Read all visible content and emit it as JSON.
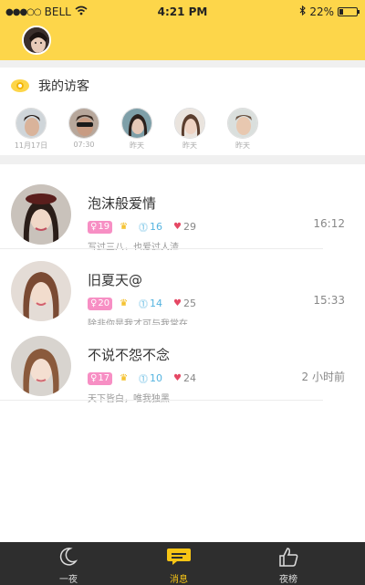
{
  "status_bar": {
    "signal": "●●●○○",
    "carrier": "BELL",
    "time": "4:21 PM",
    "battery": "22%",
    "battery_level": 0.22
  },
  "visitors": {
    "title": "我的访客",
    "items": [
      {
        "time": "11月17日"
      },
      {
        "time": "07:30"
      },
      {
        "time": "昨天"
      },
      {
        "time": "昨天"
      },
      {
        "time": "昨天"
      }
    ]
  },
  "messages": [
    {
      "name": "泡沫般爱情",
      "level": "19",
      "medal": "16",
      "hearts": "29",
      "signature": "写过三八，也爱过人渣",
      "time": "16:12"
    },
    {
      "name": "旧夏天@",
      "level": "20",
      "medal": "14",
      "hearts": "25",
      "signature": "除非你是我才可与我常在",
      "time": "15:33"
    },
    {
      "name": "不说不怨不念",
      "level": "17",
      "medal": "10",
      "hearts": "24",
      "signature": "天下皆白，唯我独黑",
      "time": "2 小时前"
    }
  ],
  "tabs": [
    {
      "label": "一夜",
      "icon": "moon-icon"
    },
    {
      "label": "消息",
      "icon": "chat-bubble-icon"
    },
    {
      "label": "夜榜",
      "icon": "thumbs-up-icon"
    }
  ],
  "colors": {
    "accent": "#fdd64a",
    "badge": "#f78fc4",
    "tabbar": "#2e2e2e",
    "active_tab": "#f7c515"
  }
}
